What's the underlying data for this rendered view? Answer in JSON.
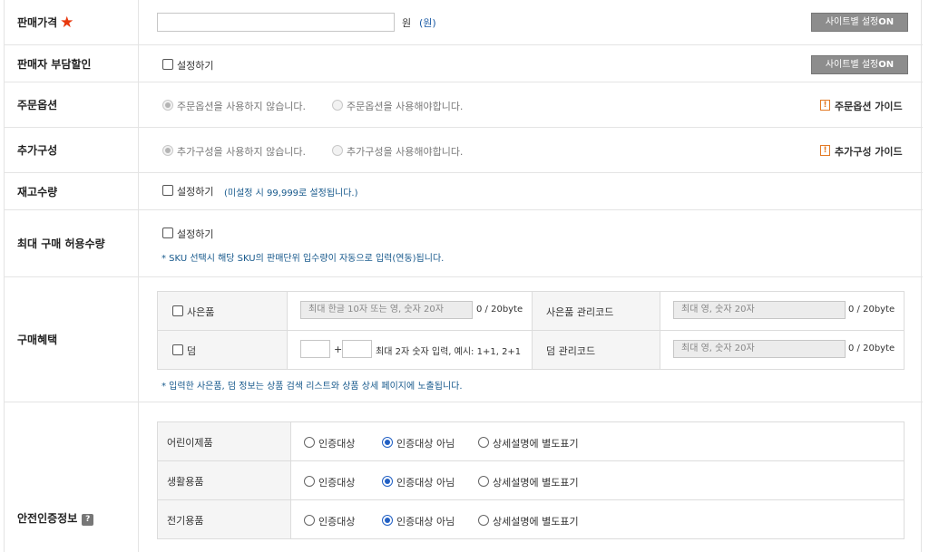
{
  "price": {
    "label": "판매가격",
    "unit": "원",
    "unit_note": "(원)",
    "site_button": "사이트별 설정",
    "site_button_on": "ON"
  },
  "seller_discount": {
    "label": "판매자 부담할인",
    "checkbox_label": "설정하기",
    "site_button": "사이트별 설정",
    "site_button_on": "ON"
  },
  "order_option": {
    "label": "주문옵션",
    "radio_no": "주문옵션을 사용하지 않습니다.",
    "radio_yes": "주문옵션을 사용해야합니다.",
    "guide": "주문옵션 가이드"
  },
  "extra_config": {
    "label": "추가구성",
    "radio_no": "추가구성을 사용하지 않습니다.",
    "radio_yes": "추가구성을 사용해야합니다.",
    "guide": "추가구성 가이드"
  },
  "stock": {
    "label": "재고수량",
    "checkbox_label": "설정하기",
    "note": "(미설정 시 99,999로 설정됩니다.)"
  },
  "max_purchase": {
    "label": "최대 구매 허용수량",
    "checkbox_label": "설정하기",
    "note": "* SKU 선택시 해당 SKU의 판매단위 입수량이 자동으로 입력(연동)됩니다."
  },
  "benefit": {
    "label": "구매혜택",
    "gift_label": "사은품",
    "gift_placeholder": "최대 한글 10자 또는 영, 숫자 20자",
    "gift_bytes": "0 / 20byte",
    "gift_code_label": "사은품 관리코드",
    "gift_code_placeholder": "최대 영, 숫자 20자",
    "gift_code_bytes": "0 / 20byte",
    "extra_label": "덤",
    "plus": "+",
    "extra_hint": "최대 2자 숫자 입력, 예시: 1+1, 2+1",
    "extra_code_label": "덤 관리코드",
    "extra_code_placeholder": "최대 영, 숫자 20자",
    "extra_code_bytes": "0 / 20byte",
    "note": "* 입력한 사은품, 덤 정보는 상품 검색 리스트와 상품 상세 페이지에 노출됩니다."
  },
  "safety": {
    "label": "안전인증정보",
    "help_icon": "?",
    "options": [
      "인증대상",
      "인증대상 아님",
      "상세설명에 별도표기"
    ],
    "rows": [
      {
        "name": "어린이제품",
        "selected": 1
      },
      {
        "name": "생활용품",
        "selected": 1
      },
      {
        "name": "전기용품",
        "selected": 1
      }
    ]
  },
  "colors": {
    "accent_blue": "#2260c4",
    "star_red": "#e8380d",
    "guide_orange": "#e37a25",
    "button_gray": "#8d8d8d"
  }
}
